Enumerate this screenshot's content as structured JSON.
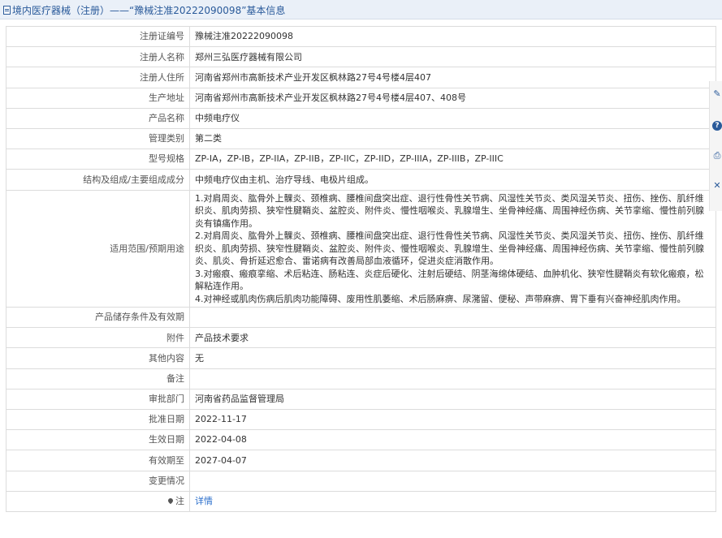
{
  "header": {
    "title": "境内医疗器械（注册）——“豫械注准20222090098”基本信息"
  },
  "fields": [
    {
      "label": "注册证编号",
      "value": "豫械注准20222090098"
    },
    {
      "label": "注册人名称",
      "value": "郑州三弘医疗器械有限公司"
    },
    {
      "label": "注册人住所",
      "value": "河南省郑州市高新技术产业开发区枫林路27号4号楼4层407"
    },
    {
      "label": "生产地址",
      "value": "河南省郑州市高新技术产业开发区枫林路27号4号楼4层407、408号"
    },
    {
      "label": "产品名称",
      "value": "中频电疗仪"
    },
    {
      "label": "管理类别",
      "value": "第二类"
    },
    {
      "label": "型号规格",
      "value": "ZP-IA，ZP-IB，ZP-IIA，ZP-IIB，ZP-IIC，ZP-IID，ZP-IIIA，ZP-IIIB，ZP-IIIC"
    },
    {
      "label": "结构及组成/主要组成成分",
      "value": "中频电疗仪由主机、治疗导线、电极片组成。"
    },
    {
      "label": "适用范围/预期用途",
      "value": ""
    },
    {
      "label": "产品储存条件及有效期",
      "value": ""
    },
    {
      "label": "附件",
      "value": "产品技术要求"
    },
    {
      "label": "其他内容",
      "value": "无"
    },
    {
      "label": "备注",
      "value": ""
    },
    {
      "label": "审批部门",
      "value": "河南省药品监督管理局"
    },
    {
      "label": "批准日期",
      "value": "2022-11-17"
    },
    {
      "label": "生效日期",
      "value": "2022-04-08"
    },
    {
      "label": "有效期至",
      "value": "2027-04-07"
    },
    {
      "label": "变更情况",
      "value": ""
    },
    {
      "label": "注",
      "value": "详情"
    }
  ],
  "usage_lines": [
    "1.对肩周炎、肱骨外上髁炎、颈椎病、腰椎间盘突出症、退行性骨性关节病、风湿性关节炎、类风湿关节炎、扭伤、挫伤、肌纤维织炎、肌肉劳损、狭窄性腱鞘炎、盆腔炎、附件炎、慢性咽喉炎、乳腺增生、坐骨神经痛、周围神经伤病、关节挛缩、慢性前列腺炎有镇痛作用。",
    "2.对肩周炎、肱骨外上髁炎、颈椎病、腰椎间盘突出症、退行性骨性关节病、风湿性关节炎、类风湿关节炎、扭伤、挫伤、肌纤维织炎、肌肉劳损、狭窄性腱鞘炎、盆腔炎、附件炎、慢性咽喉炎、乳腺增生、坐骨神经痛、周围神经伤病、关节挛缩、慢性前列腺炎、肌炎、骨折延迟愈合、雷诺病有改善局部血液循环，促进炎症消散作用。",
    "3.对瘢痕、瘢痕挛缩、术后粘连、肠粘连、炎症后硬化、注射后硬结、阴茎海绵体硬结、血肿机化、狭窄性腱鞘炎有软化瘢痕，松解粘连作用。",
    "4.对神经或肌肉伤病后肌肉功能障碍、废用性肌萎缩、术后肠麻痹、尿潴留、便秘、声带麻痹、胃下垂有兴奋神经肌肉作用。"
  ],
  "side_toolbar": [
    "edit-icon",
    "help-icon",
    "print-icon",
    "close-icon"
  ]
}
